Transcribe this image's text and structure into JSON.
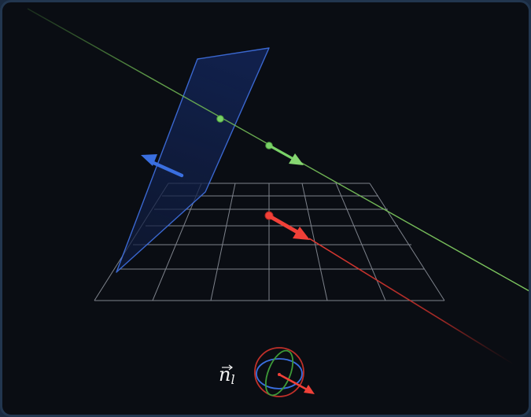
{
  "gizmo": {
    "label_main": "n",
    "label_sub": "l"
  },
  "colors": {
    "background": "#0a0d13",
    "frame_border": "#22364f",
    "grid": "#8a8f99",
    "plane_fill": "#14244a",
    "plane_edge": "#3f6fe0",
    "blue_arrow": "#3a6fe0",
    "green_line": "#73c05a",
    "green_point": "#79d167",
    "red_line": "#e03a32",
    "red_arrow": "#f04038",
    "label": "#f2f2f2"
  },
  "icons": {
    "orientation_gizmo": "rotation-gizmo-icon",
    "normal_arrow": "arrow-icon"
  }
}
